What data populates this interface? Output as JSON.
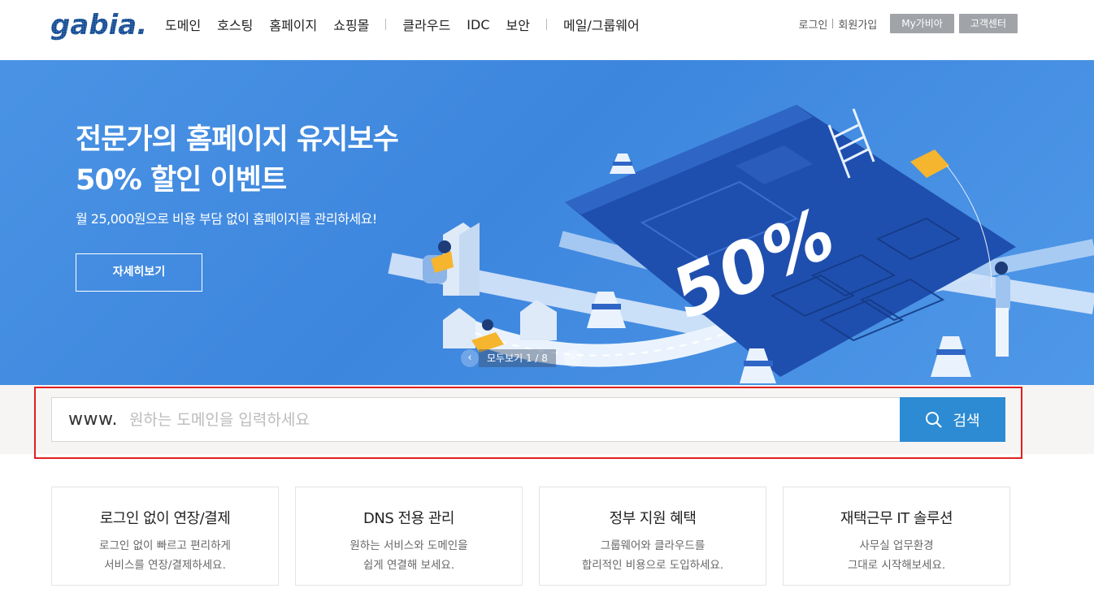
{
  "header": {
    "logo_text": "gabia.",
    "nav": [
      "도메인",
      "호스팅",
      "홈페이지",
      "쇼핑몰",
      "클라우드",
      "IDC",
      "보안",
      "메일/그룹웨어"
    ],
    "login": "로그인",
    "signup": "회원가입",
    "my_button": "My가비아",
    "support_button": "고객센터"
  },
  "hero": {
    "title_line1": "전문가의 홈페이지 유지보수",
    "title_line2": "50% 할인 이벤트",
    "subtitle": "월 25,000원으로 비용 부담 없이 홈페이지를 관리하세요!",
    "cta": "자세히보기",
    "art_text": "50%",
    "pager_label": "모두보기  1 / 8",
    "prev_icon": "chevron-left-icon",
    "next_icon": "chevron-right-icon"
  },
  "search": {
    "prefix": "www.",
    "placeholder": "원하는 도메인을 입력하세요",
    "button_label": "검색",
    "button_icon": "search-icon"
  },
  "cards": [
    {
      "title": "로그인 없이 연장/결제",
      "desc": "로그인 없이 빠르고 편리하게\n서비스를 연장/결제하세요."
    },
    {
      "title": "DNS 전용 관리",
      "desc": "원하는 서비스와 도메인을\n쉽게 연결해 보세요."
    },
    {
      "title": "정부 지원 혜택",
      "desc": "그룹웨어와 클라우드를\n합리적인 비용으로 도입하세요."
    },
    {
      "title": "재택근무 IT 솔루션",
      "desc": "사무실 업무환경\n그대로 시작해보세요."
    }
  ],
  "colors": {
    "hero_bg": "#4a93e4",
    "search_button": "#2d8bd3",
    "highlight_box": "#e02020",
    "util_button": "#a0a3a8"
  }
}
